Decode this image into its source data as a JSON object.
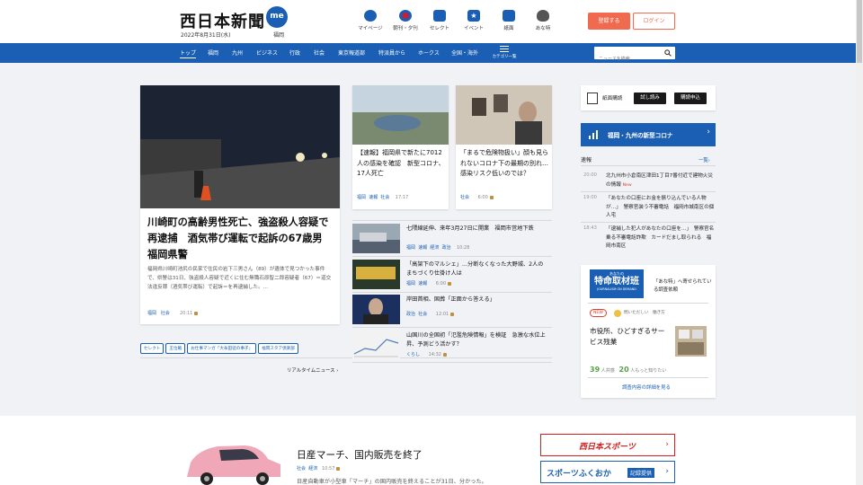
{
  "header": {
    "logo": "西日本新聞",
    "me_badge": "me",
    "date": "2022年8月31日(水)",
    "region": "福岡",
    "icons": [
      {
        "label": "マイページ",
        "icon": "me-icon",
        "color": "#1a5fb4"
      },
      {
        "label": "朝刊・夕刊",
        "icon": "newspaper-icon",
        "color": "#c0203a"
      },
      {
        "label": "セレクト",
        "icon": "select-icon",
        "color": "#1a5fb4"
      },
      {
        "label": "イベント",
        "icon": "star-icon",
        "color": "#1a5fb4"
      },
      {
        "label": "紙面",
        "icon": "paper-icon",
        "color": "#1a5fb4"
      },
      {
        "label": "あな特",
        "icon": "cat-icon",
        "color": "#333333"
      }
    ],
    "register": "登録する",
    "login": "ログイン"
  },
  "nav": {
    "items": [
      "トップ",
      "福岡",
      "九州",
      "ビジネス",
      "行政",
      "社会",
      "東京報道部",
      "特派員から",
      "ホークス",
      "全国・海外"
    ],
    "category": "カテゴリ一覧",
    "search_placeholder": "ニュースを検索"
  },
  "lead": {
    "title": "川崎町の高齢男性死亡、強盗殺人容疑で再逮捕　酒気帯び運転で起訴の67歳男　福岡県警",
    "summary": "福岡県川崎町池尻の民家で住民の岩下三男さん（89）が遺体で見つかった事件で、県警は31日、強盗殺人容疑で近くに住む無職石原智二郎容疑者（67）＝道交法違反罪（酒気帯び運転）で起訴＝を再逮捕した。...",
    "tags": [
      "福岡",
      "社会"
    ],
    "time": "20:11"
  },
  "chips": [
    "セレクト",
    "王位戦",
    "お仕事マンガ「大牟田徒の事子」",
    "福岡スタア倶楽部"
  ],
  "realtime_link": "リアルタイムニュース",
  "cards": [
    {
      "title": "【速報】福岡県で新たに7012人の感染を確認　新型コロナ、17人死亡",
      "tags": [
        "福岡",
        "速報",
        "社会"
      ],
      "time": "17:17"
    },
    {
      "title": "「まるで危険物扱い」顔も見られないコロナ下の最期の別れ…感染リスク低いのでは？",
      "tags": [
        "社会"
      ],
      "time": "6:00"
    }
  ],
  "list": [
    {
      "title": "七隈線延伸、来年3月27日に開業　福岡市営地下鉄",
      "tags": [
        "福岡",
        "速報",
        "経済",
        "政治"
      ],
      "time": "10:28"
    },
    {
      "title": "「高架下のマルシェ」…分断なくなった大野城、2人のまちづくり仕掛け人は",
      "tags": [
        "福岡",
        "速報"
      ],
      "time": "6:00"
    },
    {
      "title": "岸田首相、国葬「正面から答える」",
      "tags": [
        "政治",
        "社会"
      ],
      "time": "12:01"
    },
    {
      "title": "山国川の全国初「氾濫危険情報」を検証　急激な水位上昇、予測どう活かす？",
      "tags": [
        "くらし"
      ],
      "time": "14:32"
    }
  ],
  "right": {
    "subscribe_label": "紙面購読",
    "trial": "試し読み",
    "apply": "購読申込",
    "corona": "福岡・九州の新型コロナ",
    "breaking": "速報",
    "list_all": "一覧",
    "breaking_items": [
      {
        "time": "20:00",
        "text": "北九州市小倉南区津田1丁目7番付近で建物火災の情報",
        "new": "New"
      },
      {
        "time": "19:00",
        "text": "「あなたの口座にお金を振り込んでいる人物が…」　警察官装う不審電話　福岡市城南区の個人宅",
        "new": ""
      },
      {
        "time": "18:43",
        "text": "「逮捕した犯人があなたの口座を…」　警察官名乗る不審電話詐欺　カードだまし取られる　福岡市南区",
        "new": ""
      }
    ],
    "tokumei": {
      "small": "あなたの",
      "big": "特命取材班",
      "eng": "JOURNALISM ON DEMAND",
      "desc": "「あな特」へ寄せられている調査依頼",
      "new": "NEW",
      "q": "問いただしい",
      "who": "働き方",
      "title": "市役所、ひどすぎるサービス残業",
      "stat1": "39",
      "stat1_label": "人共感",
      "stat2": "20",
      "stat2_label": "人もっと知りたい",
      "more": "調査内容の詳細を見る"
    }
  },
  "lower": {
    "title": "日産マーチ、国内販売を終了",
    "tags": [
      "社会",
      "経済"
    ],
    "time": "10:57",
    "summary": "日産自動車が小型車「マーチ」の国内販売を終えることが31日、分かった。",
    "banner1": "西日本スポーツ",
    "banner2": "スポーツふくおか",
    "banner2_tag": "記録提供"
  },
  "colors": {
    "brand": "#1a5fb4",
    "accent": "#f06a4f",
    "bg": "#f0f2f5"
  }
}
